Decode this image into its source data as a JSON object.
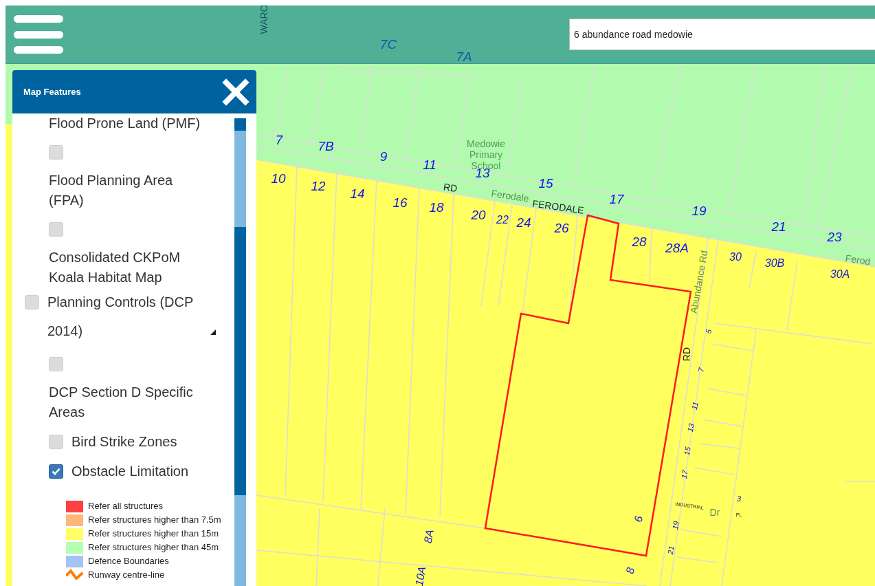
{
  "header": {
    "search": {
      "value": "6 abundance road medowie"
    }
  },
  "panel": {
    "title": "Map Features",
    "layers": [
      {
        "label": "Flood Prone Land (PMF)",
        "kind": "label"
      },
      {
        "label": "Flood Planning Area (FPA)",
        "checked": false,
        "kind": "stacked"
      },
      {
        "label": "Consolidated CKPoM Koala Habitat Map",
        "checked": false,
        "kind": "stacked"
      },
      {
        "label": "Planning Controls (DCP 2014)",
        "checked": false,
        "kind": "group",
        "expanded": true,
        "children": [
          {
            "label": "DCP Section D Specific Areas",
            "checked": false,
            "kind": "stacked"
          },
          {
            "label": "Bird Strike Zones",
            "checked": false,
            "kind": "inline"
          },
          {
            "label": "Obstacle Limitation",
            "checked": true,
            "kind": "inline",
            "legend": [
              {
                "label": "Refer all structures",
                "kind": "swatch",
                "color": "#ff4040"
              },
              {
                "label": "Refer structures higher than 7.5m",
                "kind": "swatch",
                "color": "#ffb67a"
              },
              {
                "label": "Refer structures higher than 15m",
                "kind": "swatch",
                "color": "#ffff66"
              },
              {
                "label": "Refer structures higher than 45m",
                "kind": "swatch",
                "color": "#b3ffb3"
              },
              {
                "label": "Defence Boundaries",
                "kind": "swatch",
                "color": "#a4c2f4"
              },
              {
                "label": "Runway centre-line",
                "kind": "line",
                "color": "#ff8000"
              }
            ]
          }
        ]
      }
    ]
  },
  "map_labels": [
    {
      "text": "WARO",
      "kind": "road"
    },
    {
      "text": "7C",
      "kind": "lot"
    },
    {
      "text": "7A",
      "kind": "lot"
    },
    {
      "text": "7",
      "kind": "lot"
    },
    {
      "text": "7B",
      "kind": "lot"
    },
    {
      "text": "9",
      "kind": "lot"
    },
    {
      "text": "11",
      "kind": "lot"
    },
    {
      "text": "13",
      "kind": "lot"
    },
    {
      "text": "15",
      "kind": "lot"
    },
    {
      "text": "17",
      "kind": "lot"
    },
    {
      "text": "19",
      "kind": "lot"
    },
    {
      "text": "21",
      "kind": "lot"
    },
    {
      "text": "23",
      "kind": "lot"
    },
    {
      "text": "10",
      "kind": "lot"
    },
    {
      "text": "12",
      "kind": "lot"
    },
    {
      "text": "14",
      "kind": "lot"
    },
    {
      "text": "16",
      "kind": "lot"
    },
    {
      "text": "18",
      "kind": "lot"
    },
    {
      "text": "20",
      "kind": "lot"
    },
    {
      "text": "22",
      "kind": "lot_small"
    },
    {
      "text": "24",
      "kind": "lot"
    },
    {
      "text": "26",
      "kind": "lot"
    },
    {
      "text": "28",
      "kind": "lot"
    },
    {
      "text": "28A",
      "kind": "lot"
    },
    {
      "text": "30",
      "kind": "lot_small"
    },
    {
      "text": "30B",
      "kind": "lot_small"
    },
    {
      "text": "30A",
      "kind": "lot_small"
    },
    {
      "text": "5",
      "kind": "lot_tiny"
    },
    {
      "text": "7",
      "kind": "lot_tiny"
    },
    {
      "text": "11",
      "kind": "lot_tiny"
    },
    {
      "text": "13",
      "kind": "lot_tiny"
    },
    {
      "text": "15",
      "kind": "lot_tiny"
    },
    {
      "text": "17",
      "kind": "lot_tiny"
    },
    {
      "text": "3",
      "kind": "lot_tiny"
    },
    {
      "text": "19",
      "kind": "lot_tiny"
    },
    {
      "text": "21",
      "kind": "lot_tiny"
    },
    {
      "text": "6",
      "kind": "lot_small"
    },
    {
      "text": "8",
      "kind": "lot_small"
    },
    {
      "text": "8A",
      "kind": "lot_small"
    },
    {
      "text": "10A",
      "kind": "lot_small"
    },
    {
      "text": "RD",
      "kind": "road"
    },
    {
      "text": "Ferodale",
      "kind": "road_faint"
    },
    {
      "text": "FERODALE",
      "kind": "road"
    },
    {
      "text": "Ferod",
      "kind": "road_faint"
    },
    {
      "text": "Abundance Rd",
      "kind": "road_faint"
    },
    {
      "text": "RD",
      "kind": "road"
    },
    {
      "text": "INDUSTRIAL",
      "kind": "road_tiny"
    },
    {
      "text": "Dr",
      "kind": "road_faint"
    },
    {
      "text": "PL",
      "kind": "road_tiny"
    },
    {
      "text": "Medowie",
      "kind": "place"
    },
    {
      "text": "Primary",
      "kind": "place"
    },
    {
      "text": "School",
      "kind": "place"
    }
  ]
}
